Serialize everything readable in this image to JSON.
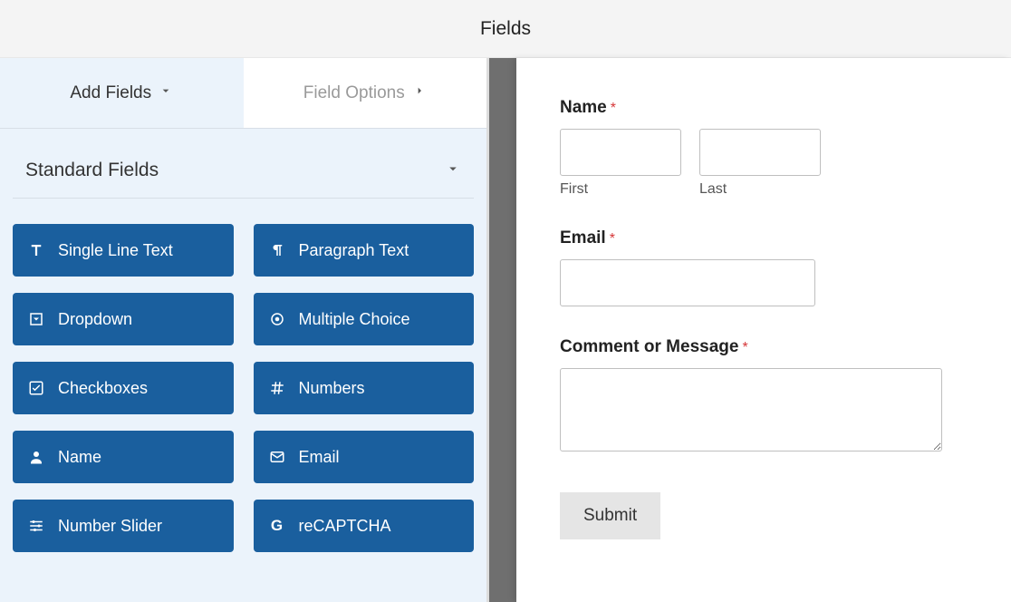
{
  "header": {
    "title": "Fields"
  },
  "tabs": {
    "add_fields": "Add Fields",
    "field_options": "Field Options"
  },
  "section": {
    "title": "Standard Fields"
  },
  "field_buttons": [
    {
      "icon": "text-icon",
      "label": "Single Line Text"
    },
    {
      "icon": "paragraph-icon",
      "label": "Paragraph Text"
    },
    {
      "icon": "dropdown-icon",
      "label": "Dropdown"
    },
    {
      "icon": "radio-icon",
      "label": "Multiple Choice"
    },
    {
      "icon": "checkbox-icon",
      "label": "Checkboxes"
    },
    {
      "icon": "hash-icon",
      "label": "Numbers"
    },
    {
      "icon": "user-icon",
      "label": "Name"
    },
    {
      "icon": "mail-icon",
      "label": "Email"
    },
    {
      "icon": "sliders-icon",
      "label": "Number Slider"
    },
    {
      "icon": "g-icon",
      "label": "reCAPTCHA"
    }
  ],
  "form": {
    "name_label": "Name",
    "first_sub": "First",
    "last_sub": "Last",
    "email_label": "Email",
    "message_label": "Comment or Message",
    "submit_label": "Submit",
    "required_mark": "*"
  }
}
